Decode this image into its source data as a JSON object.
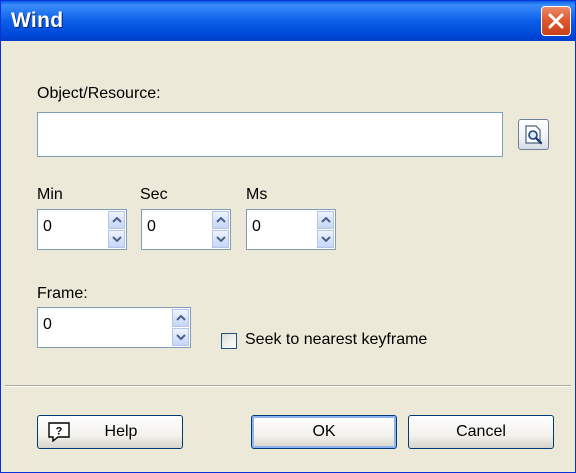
{
  "window": {
    "title": "Wind"
  },
  "fields": {
    "object_label": "Object/Resource:",
    "object_value": "",
    "min_label": "Min",
    "sec_label": "Sec",
    "ms_label": "Ms",
    "min_value": "0",
    "sec_value": "0",
    "ms_value": "0",
    "frame_label": "Frame:",
    "frame_value": "0",
    "seek_label": "Seek to nearest keyframe",
    "seek_checked": false
  },
  "buttons": {
    "help": "Help",
    "ok": "OK",
    "cancel": "Cancel"
  },
  "icons": [
    "close-icon",
    "browse-icon",
    "up-arrow-icon",
    "down-arrow-icon",
    "help-icon"
  ],
  "colors": {
    "title_bar": "#0a5fe8",
    "dialog_bg": "#ece9d8",
    "close_button": "#e05a30"
  }
}
